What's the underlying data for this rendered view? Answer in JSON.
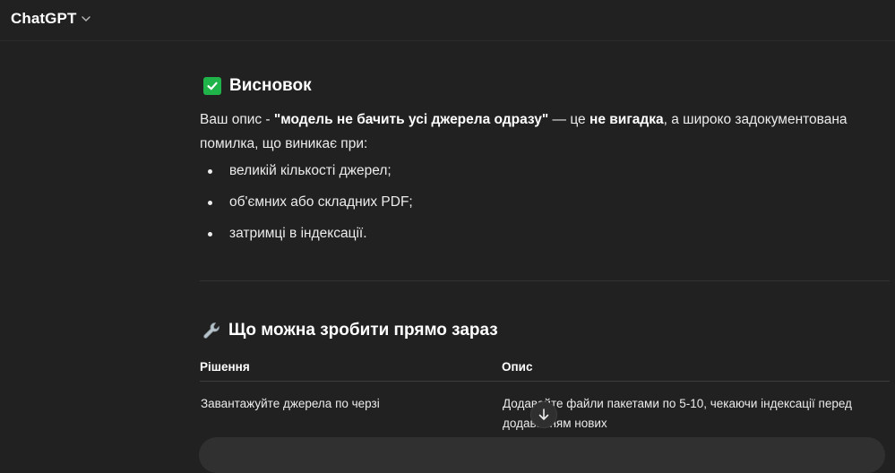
{
  "header": {
    "model_name": "ChatGPT"
  },
  "section1": {
    "heading": "Висновок",
    "heading_icon": "check-mark-button-emoji",
    "para_prefix": "Ваш опис - ",
    "para_bold1": "\"модель не бачить усі джерела одразу\"",
    "para_mid": " — це ",
    "para_bold2": "не вигадка",
    "para_suffix": ", а широко задокументована помилка, що виникає при:",
    "bullets": [
      "великій кількості джерел;",
      "об'ємних або складних PDF;",
      "затримці в індексації."
    ]
  },
  "section2": {
    "heading": "Що можна зробити прямо зараз",
    "heading_icon": "wrench-emoji",
    "table": {
      "headers": [
        "Рішення",
        "Опис"
      ],
      "rows": [
        [
          "Завантажуйте джерела по черзі",
          "Додавайте файли пакетами по 5-10, чекаючи індексації перед додаванням нових"
        ]
      ]
    }
  },
  "colors": {
    "background": "#212121",
    "text": "#ececec",
    "check_green": "#1fb34a"
  }
}
